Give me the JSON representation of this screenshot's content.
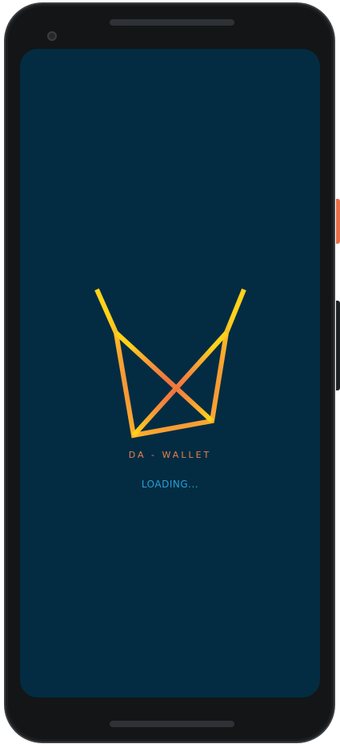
{
  "app": {
    "brand_name": "DA - WALLET",
    "status_text": "LOADING..."
  },
  "logo": {
    "icon": "w-logo-icon",
    "gradient_outer": "#ffd21a",
    "gradient_center": "#f06a3e"
  },
  "colors": {
    "screen_background": "#032c43",
    "brand_text": "#e8824a",
    "status_text": "#2a9fd4"
  }
}
